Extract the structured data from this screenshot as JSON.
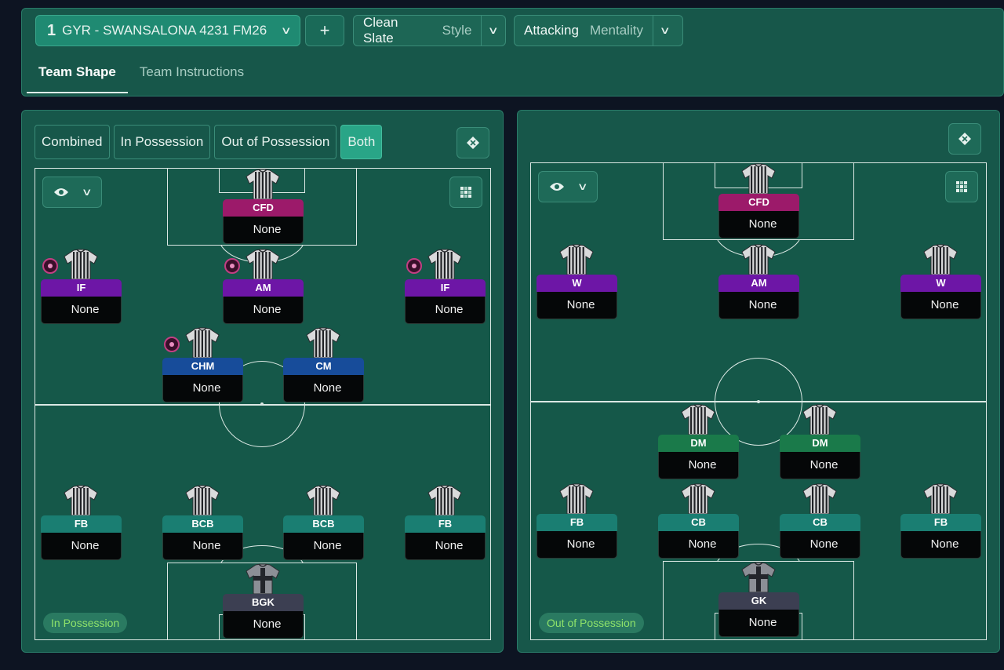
{
  "tactic": {
    "number": "1",
    "name": "GYR - SWANSALONA 4231 FM26"
  },
  "header": {
    "add_label": "+",
    "style": {
      "value": "Clean Slate",
      "label": "Style"
    },
    "mentality": {
      "value": "Attacking",
      "label": "Mentality"
    }
  },
  "tabs": [
    {
      "label": "Team Shape",
      "active": true
    },
    {
      "label": "Team Instructions",
      "active": false
    }
  ],
  "view_toggle": {
    "options": [
      "Combined",
      "In Possession",
      "Out of Possession",
      "Both"
    ],
    "selected": "Both"
  },
  "in_possession": {
    "phase_label": "In Possession",
    "players": [
      {
        "role": "CFD",
        "name": "None",
        "kind": "att"
      },
      {
        "role": "IF",
        "name": "None",
        "kind": "am",
        "badge": true
      },
      {
        "role": "AM",
        "name": "None",
        "kind": "am",
        "badge": true
      },
      {
        "role": "IF",
        "name": "None",
        "kind": "am",
        "badge": true
      },
      {
        "role": "CHM",
        "name": "None",
        "kind": "mid",
        "badge": true
      },
      {
        "role": "CM",
        "name": "None",
        "kind": "mid"
      },
      {
        "role": "FB",
        "name": "None",
        "kind": "def"
      },
      {
        "role": "BCB",
        "name": "None",
        "kind": "def"
      },
      {
        "role": "BCB",
        "name": "None",
        "kind": "def"
      },
      {
        "role": "FB",
        "name": "None",
        "kind": "def"
      },
      {
        "role": "BGK",
        "name": "None",
        "kind": "gk"
      }
    ]
  },
  "out_of_possession": {
    "phase_label": "Out of Possession",
    "players": [
      {
        "role": "CFD",
        "name": "None",
        "kind": "att"
      },
      {
        "role": "W",
        "name": "None",
        "kind": "am"
      },
      {
        "role": "AM",
        "name": "None",
        "kind": "am"
      },
      {
        "role": "W",
        "name": "None",
        "kind": "am"
      },
      {
        "role": "DM",
        "name": "None",
        "kind": "dm"
      },
      {
        "role": "DM",
        "name": "None",
        "kind": "dm"
      },
      {
        "role": "FB",
        "name": "None",
        "kind": "def"
      },
      {
        "role": "CB",
        "name": "None",
        "kind": "def"
      },
      {
        "role": "CB",
        "name": "None",
        "kind": "def"
      },
      {
        "role": "FB",
        "name": "None",
        "kind": "def"
      },
      {
        "role": "GK",
        "name": "None",
        "kind": "gk"
      }
    ]
  },
  "icons": {
    "dropdown": "chevron-down-icon",
    "add": "plus-icon",
    "tactics_board": "tactics-board-icon",
    "visibility": "eye-icon",
    "grid": "grid-icon",
    "instruction_badge": "player-instruction-icon",
    "shirt": "striped-shirt-icon"
  },
  "colors": {
    "panel": "#17574a",
    "pitch": "#155849",
    "selected_toggle": "#29a587",
    "attack_role": "#9c1a6a",
    "attacking_mid_role": "#6d16a6",
    "midfield_role": "#174c9a",
    "defensive_mid_role": "#1a7a4a",
    "defender_role": "#1a7e72",
    "goalkeeper_role": "#3c3f52",
    "phase_label_text": "#8fe36a"
  }
}
